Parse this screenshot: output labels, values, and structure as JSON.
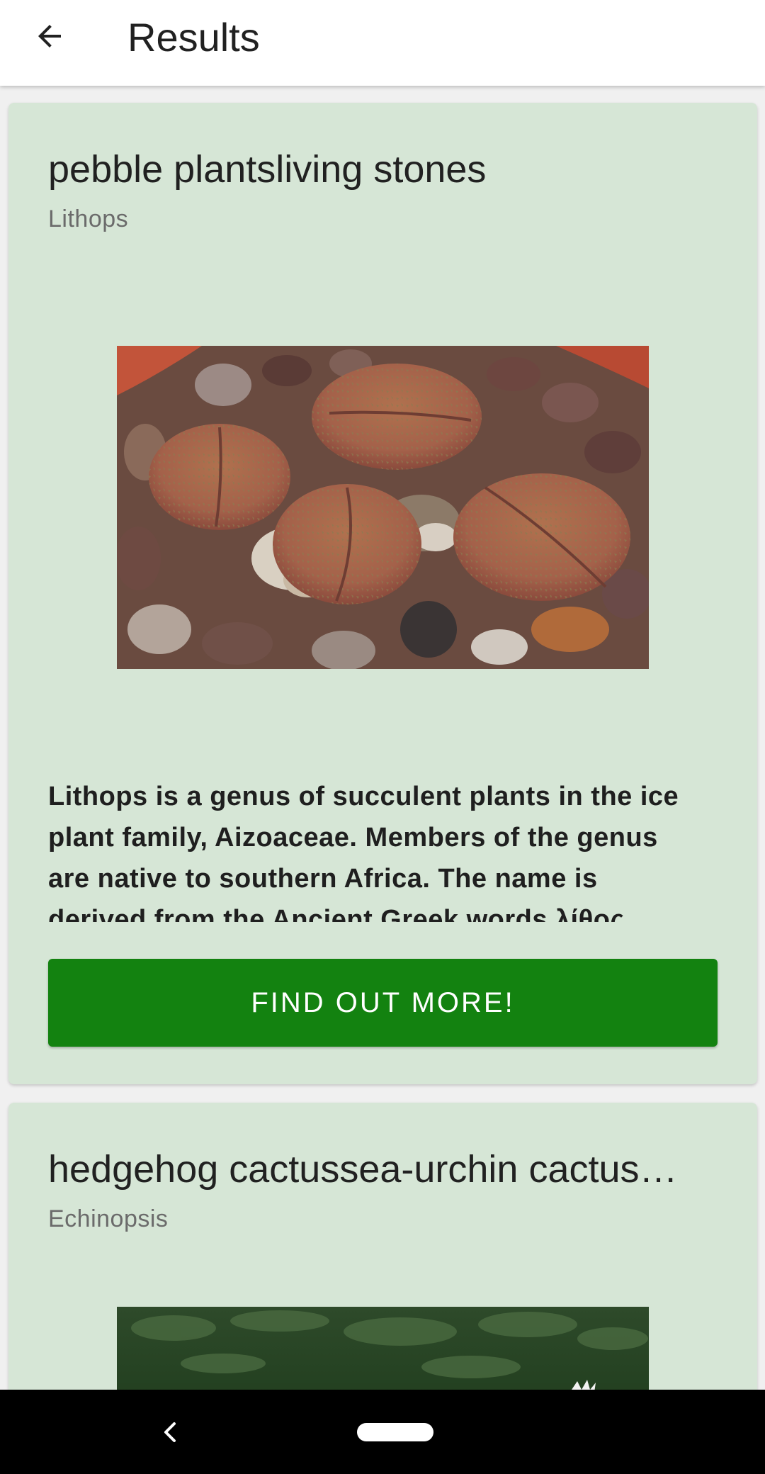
{
  "app_bar": {
    "title": "Results",
    "back_icon": "arrow-back-icon"
  },
  "results": [
    {
      "title": "pebble plantsliving stones",
      "subtitle": "Lithops",
      "image_icon": "lithops-photo",
      "description": "Lithops is a genus of succulent plants in the ice plant family, Aizoaceae. Members of the genus are native to southern Africa. The name is derived from the Ancient Greek words λίθος (líthos), meaning \"stone\", and ὄψ (óps), meaning \"face\", referring to the stone-like appearance of the plants.",
      "button_label": "FIND OUT MORE!"
    },
    {
      "title": "hedgehog cactussea-urchin cactus…",
      "subtitle": "Echinopsis",
      "image_icon": "echinopsis-photo"
    }
  ],
  "colors": {
    "card_background": "#d6e6d6",
    "button_green": "#138210",
    "app_bar": "#ffffff",
    "nav_bar": "#000000"
  },
  "system_nav": {
    "back_icon": "nav-back-icon",
    "home_icon": "nav-home-pill"
  }
}
